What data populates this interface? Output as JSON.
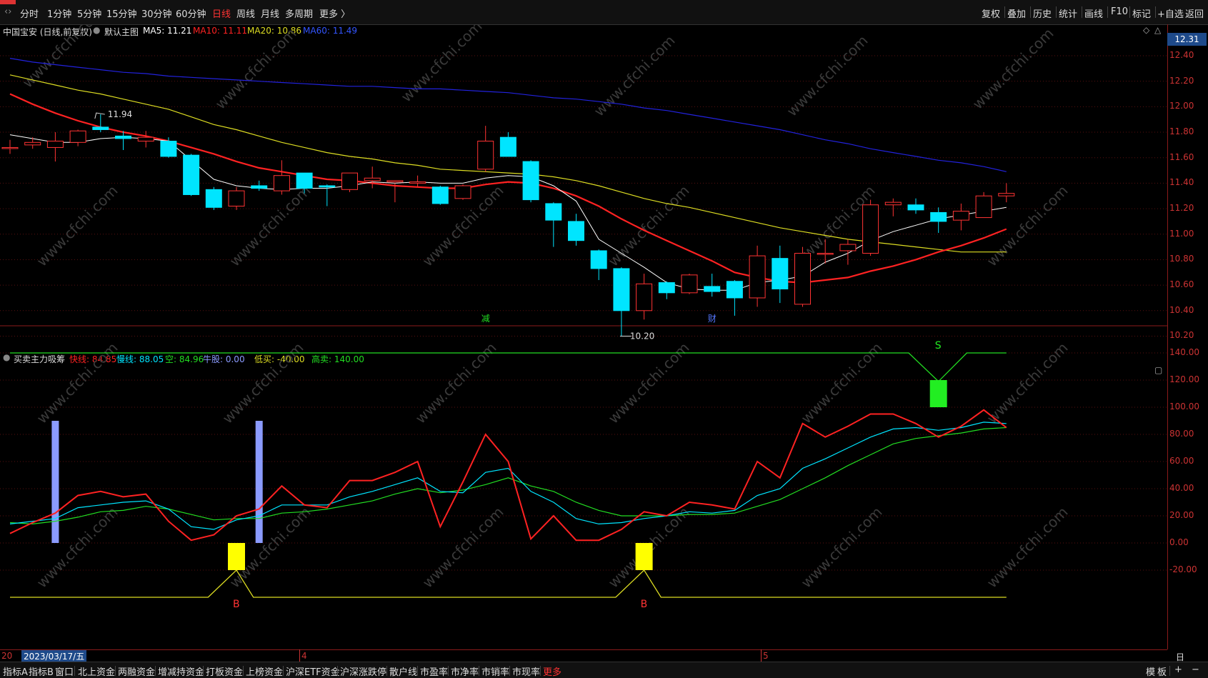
{
  "toolbar": {
    "periods": [
      "分时",
      "1分钟",
      "5分钟",
      "15分钟",
      "30分钟",
      "60分钟",
      "日线",
      "周线",
      "月线",
      "多周期",
      "更多 〉"
    ],
    "active_period": "日线",
    "right_tools": [
      "复权",
      "叠加",
      "历史",
      "统计",
      "画线",
      "F10",
      "标记",
      "+自选",
      "返回"
    ]
  },
  "main_panel": {
    "stock": "中国宝安 (日线,前复权)",
    "template": "默认主图",
    "ma5": "MA5: 11.21",
    "ma10": "MA10: 11.11",
    "ma20": "MA20: 10.86",
    "ma60": "MA60: 11.49",
    "high_note": "11.94",
    "low_note": "10.20",
    "event_jian": "减",
    "event_cai": "财",
    "current_price": "12.31",
    "ylabels": [
      "12.40",
      "12.20",
      "12.00",
      "11.80",
      "11.60",
      "11.40",
      "11.20",
      "11.00",
      "10.80",
      "10.60",
      "10.40",
      "10.20"
    ]
  },
  "indicator_panel": {
    "name": "买卖主力吸筹",
    "fast": "快线: 84.85",
    "slow": "慢线: 88.05",
    "kong": "空: 84.96",
    "niugu": "牛股: 0.00",
    "dimai": "低买: -40.00",
    "gaomai": "高卖: 140.00",
    "ylabels": [
      "140.00",
      "120.00",
      "100.00",
      "80.00",
      "60.00",
      "40.00",
      "20.00",
      "0.00",
      "-20.00"
    ],
    "buy_mark": "B",
    "sell_mark": "S"
  },
  "date_axis": {
    "cursor_date": "2023/03/17/五",
    "prefix": "20",
    "month4": "4",
    "month5": "5",
    "right_label": "日线"
  },
  "bottom_tabs": [
    "指标A",
    "指标B",
    "窗口",
    "北上资金",
    "两融资金",
    "增减持资金",
    "打板资金",
    "上榜资金",
    "沪深ETF资金",
    "沪深涨跌停",
    "散户线",
    "市盈率",
    "市净率",
    "市销率",
    "市现率",
    "更多"
  ],
  "bottom_right": [
    "模",
    "板",
    "+",
    "−"
  ],
  "watermark": "www.cfchi.com",
  "colors": {
    "up": "#ff3333",
    "down": "#00e5ff",
    "ma5": "#ffffff",
    "ma10": "#ff2222",
    "ma20": "#dddd22",
    "ma60": "#2222dd",
    "axis": "#cc3333"
  },
  "chart_data": [
    {
      "type": "candlestick",
      "title": "中国宝安 (日线,前复权)",
      "ylim": [
        10.15,
        12.45
      ],
      "candles": [
        [
          11.68,
          11.74,
          11.63,
          11.68
        ],
        [
          11.7,
          11.76,
          11.67,
          11.72
        ],
        [
          11.68,
          11.8,
          11.57,
          11.73
        ],
        [
          11.72,
          11.82,
          11.69,
          11.81
        ],
        [
          11.84,
          11.94,
          11.8,
          11.82
        ],
        [
          11.77,
          11.81,
          11.66,
          11.75
        ],
        [
          11.73,
          11.81,
          11.68,
          11.76
        ],
        [
          11.73,
          11.76,
          11.6,
          11.61
        ],
        [
          11.62,
          11.63,
          11.3,
          11.31
        ],
        [
          11.35,
          11.37,
          11.19,
          11.21
        ],
        [
          11.22,
          11.37,
          11.19,
          11.34
        ],
        [
          11.38,
          11.42,
          11.34,
          11.36
        ],
        [
          11.34,
          11.58,
          11.31,
          11.46
        ],
        [
          11.48,
          11.48,
          11.32,
          11.36
        ],
        [
          11.38,
          11.39,
          11.22,
          11.37
        ],
        [
          11.35,
          11.45,
          11.33,
          11.48
        ],
        [
          11.42,
          11.53,
          11.36,
          11.44
        ],
        [
          11.41,
          11.4,
          11.25,
          11.42
        ],
        [
          11.4,
          11.46,
          11.37,
          11.41
        ],
        [
          11.37,
          11.38,
          11.23,
          11.24
        ],
        [
          11.28,
          11.39,
          11.27,
          11.38
        ],
        [
          11.51,
          11.85,
          11.49,
          11.73
        ],
        [
          11.76,
          11.8,
          11.61,
          11.61
        ],
        [
          11.57,
          11.58,
          11.25,
          11.27
        ],
        [
          11.24,
          11.25,
          10.9,
          11.11
        ],
        [
          11.1,
          11.16,
          10.91,
          10.95
        ],
        [
          10.87,
          10.88,
          10.64,
          10.73
        ],
        [
          10.73,
          10.74,
          10.2,
          10.4
        ],
        [
          10.4,
          10.69,
          10.33,
          10.61
        ],
        [
          10.62,
          10.63,
          10.49,
          10.54
        ],
        [
          10.54,
          10.69,
          10.53,
          10.68
        ],
        [
          10.59,
          10.69,
          10.51,
          10.55
        ],
        [
          10.63,
          10.64,
          10.36,
          10.5
        ],
        [
          10.5,
          10.91,
          10.43,
          10.83
        ],
        [
          10.81,
          10.91,
          10.46,
          10.57
        ],
        [
          10.45,
          10.9,
          10.43,
          10.85
        ],
        [
          10.85,
          10.96,
          10.77,
          10.85
        ],
        [
          10.87,
          10.96,
          10.76,
          10.92
        ],
        [
          10.85,
          11.27,
          10.83,
          11.23
        ],
        [
          11.23,
          11.28,
          11.14,
          11.25
        ],
        [
          11.23,
          11.28,
          11.16,
          11.19
        ],
        [
          11.17,
          11.21,
          11.01,
          11.1
        ],
        [
          11.11,
          11.24,
          11.03,
          11.18
        ],
        [
          11.13,
          11.33,
          11.13,
          11.3
        ],
        [
          11.3,
          11.4,
          11.25,
          11.32
        ]
      ],
      "ma5": [
        11.78,
        11.75,
        11.72,
        11.72,
        11.75,
        11.76,
        11.75,
        11.73,
        11.58,
        11.43,
        11.38,
        11.36,
        11.35,
        11.36,
        11.36,
        11.38,
        11.41,
        11.4,
        11.41,
        11.4,
        11.4,
        11.44,
        11.46,
        11.45,
        11.38,
        11.26,
        10.96,
        10.85,
        10.74,
        10.62,
        10.57,
        10.56,
        10.56,
        10.62,
        10.64,
        10.67,
        10.78,
        10.85,
        10.95,
        11.02,
        11.07,
        11.12,
        11.15,
        11.18,
        11.21
      ],
      "ma10": [
        12.1,
        12.02,
        11.95,
        11.89,
        11.84,
        11.8,
        11.77,
        11.73,
        11.68,
        11.63,
        11.57,
        11.52,
        11.49,
        11.46,
        11.43,
        11.42,
        11.4,
        11.38,
        11.37,
        11.36,
        11.36,
        11.39,
        11.41,
        11.4,
        11.36,
        11.3,
        11.22,
        11.12,
        11.03,
        10.95,
        10.87,
        10.79,
        10.7,
        10.66,
        10.63,
        10.62,
        10.64,
        10.66,
        10.71,
        10.75,
        10.8,
        10.86,
        10.91,
        10.97,
        11.04
      ],
      "ma20": [
        12.25,
        12.21,
        12.17,
        12.13,
        12.1,
        12.06,
        12.02,
        11.98,
        11.92,
        11.86,
        11.82,
        11.77,
        11.72,
        11.68,
        11.64,
        11.61,
        11.59,
        11.56,
        11.54,
        11.51,
        11.5,
        11.49,
        11.48,
        11.47,
        11.45,
        11.42,
        11.38,
        11.33,
        11.28,
        11.24,
        11.21,
        11.17,
        11.13,
        11.09,
        11.05,
        11.02,
        10.99,
        10.96,
        10.94,
        10.92,
        10.9,
        10.88,
        10.86,
        10.86,
        10.86
      ],
      "ma60": [
        12.38,
        12.35,
        12.33,
        12.31,
        12.29,
        12.27,
        12.26,
        12.24,
        12.23,
        12.22,
        12.21,
        12.2,
        12.19,
        12.18,
        12.17,
        12.16,
        12.16,
        12.15,
        12.14,
        12.14,
        12.13,
        12.12,
        12.11,
        12.09,
        12.07,
        12.06,
        12.04,
        12.02,
        11.99,
        11.97,
        11.94,
        11.91,
        11.88,
        11.85,
        11.82,
        11.78,
        11.74,
        11.71,
        11.67,
        11.64,
        11.61,
        11.58,
        11.56,
        11.53,
        11.49
      ]
    },
    {
      "type": "line",
      "title": "买卖主力吸筹",
      "ylim": [
        -30,
        150
      ],
      "series": [
        {
          "name": "快线",
          "values": [
            7,
            15,
            22,
            35,
            38,
            34,
            36,
            16,
            2,
            6,
            20,
            25,
            42,
            28,
            26,
            46,
            46,
            52,
            60,
            12,
            45,
            80,
            60,
            3,
            20,
            2,
            2,
            10,
            23,
            20,
            30,
            28,
            25,
            60,
            48,
            88,
            78,
            86,
            95,
            95,
            88,
            78,
            86,
            98,
            85
          ]
        },
        {
          "name": "慢线",
          "values": [
            14,
            16,
            18,
            26,
            28,
            30,
            31,
            25,
            12,
            10,
            17,
            20,
            28,
            28,
            28,
            34,
            38,
            43,
            48,
            38,
            37,
            52,
            55,
            38,
            30,
            18,
            14,
            15,
            18,
            20,
            23,
            22,
            24,
            35,
            40,
            55,
            62,
            70,
            78,
            84,
            85,
            83,
            85,
            89,
            88
          ]
        },
        {
          "name": "空",
          "values": [
            15,
            14,
            16,
            19,
            23,
            24,
            27,
            25,
            21,
            17,
            18,
            18,
            22,
            23,
            25,
            28,
            31,
            36,
            40,
            37,
            39,
            43,
            48,
            42,
            38,
            30,
            24,
            20,
            20,
            20,
            21,
            21,
            22,
            27,
            32,
            40,
            48,
            57,
            65,
            73,
            77,
            79,
            81,
            84,
            85
          ]
        }
      ]
    }
  ]
}
